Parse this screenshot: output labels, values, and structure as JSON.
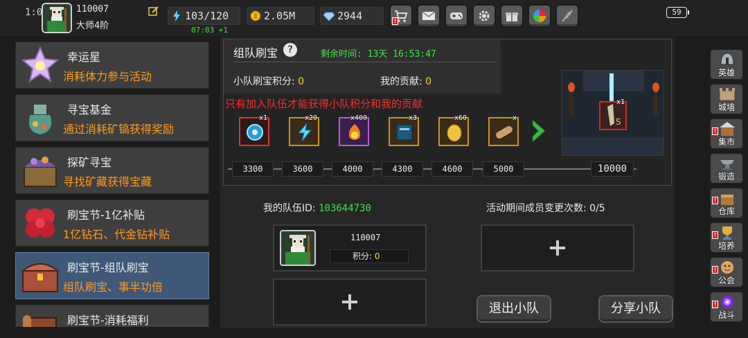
{
  "status": {
    "clock_fragment": "1:0",
    "battery": "59"
  },
  "player": {
    "id": "110007",
    "rank": "大师4阶"
  },
  "resources": {
    "energy": "103/120",
    "energy_timer": "07:03 +1",
    "gold": "2.05M",
    "gems": "2944"
  },
  "toolbar": {
    "icons": [
      "cart-icon",
      "mail-icon",
      "gamepad-icon",
      "gear-icon",
      "gift-icon",
      "color-wheel-icon",
      "feather-icon"
    ]
  },
  "events": [
    {
      "title": "幸运星",
      "desc": "消耗体力参与活动",
      "icon": "star-crystal-icon"
    },
    {
      "title": "寻宝基金",
      "desc": "通过消耗矿镐获得奖励",
      "icon": "treasure-bag-icon"
    },
    {
      "title": "探矿寻宝",
      "desc": "寻找矿藏获得宝藏",
      "icon": "mine-chest-icon"
    },
    {
      "title": "刷宝节-1亿补贴",
      "desc": "1亿钻石、代金钻补贴",
      "icon": "red-flower-icon"
    },
    {
      "title": "刷宝节-组队刷宝",
      "desc": "组队刷宝、事半功倍",
      "icon": "treasure-chest-icon"
    },
    {
      "title": "刷宝节-消耗福利",
      "desc": "",
      "icon": "scroll-chest-icon"
    }
  ],
  "panel": {
    "title": "组队刷宝",
    "remaining": "剩余时间: 13天 16:53:47",
    "squad_score_label": "小队刷宝积分:",
    "squad_score": "0",
    "my_contrib_label": "我的贡献:",
    "my_contrib": "0",
    "warning": "只有加入队伍才能获得小队积分和我的贡献",
    "rewards": [
      {
        "qty": "x1",
        "icon": "blue-orb-icon",
        "rarity": "red"
      },
      {
        "qty": "x20",
        "icon": "lightning-icon",
        "rarity": "gold"
      },
      {
        "qty": "x400",
        "icon": "fire-orb-icon",
        "rarity": "purple"
      },
      {
        "qty": "x3",
        "icon": "spellbook-icon",
        "rarity": "gold"
      },
      {
        "qty": "x60",
        "icon": "golden-egg-icon",
        "rarity": "gold"
      },
      {
        "qty": "x",
        "icon": "scroll-icon",
        "rarity": "gold"
      }
    ],
    "milestones": [
      "3300",
      "3600",
      "4000",
      "4300",
      "4600",
      "5000"
    ],
    "final_milestone": "10000",
    "final_reward": {
      "qty": "x1",
      "badge": "S"
    }
  },
  "team": {
    "id_label": "我的队伍ID:",
    "id": "103644730",
    "changes_label": "活动期间成员变更次数:",
    "changes": "0/5",
    "member": {
      "id": "110007",
      "score_label": "积分:",
      "score": "0"
    },
    "exit_label": "退出小队",
    "share_label": "分享小队"
  },
  "nav": [
    {
      "label": "英雄",
      "icon": "helmet-icon",
      "alert": false
    },
    {
      "label": "城墙",
      "icon": "wall-icon",
      "alert": false
    },
    {
      "label": "集市",
      "icon": "market-icon",
      "alert": true
    },
    {
      "label": "锻造",
      "icon": "anvil-icon",
      "alert": false
    },
    {
      "label": "仓库",
      "icon": "warehouse-icon",
      "alert": true
    },
    {
      "label": "培养",
      "icon": "trophy-icon",
      "alert": true
    },
    {
      "label": "公会",
      "icon": "guild-icon",
      "alert": true
    },
    {
      "label": "战斗",
      "icon": "portal-icon",
      "alert": true
    }
  ],
  "colors": {
    "accent_green": "#44e044",
    "accent_orange": "#ff9a1c",
    "warning_red": "#ff2a2a",
    "score_yellow": "#ffd23a",
    "selected_blue": "#3f5877"
  }
}
